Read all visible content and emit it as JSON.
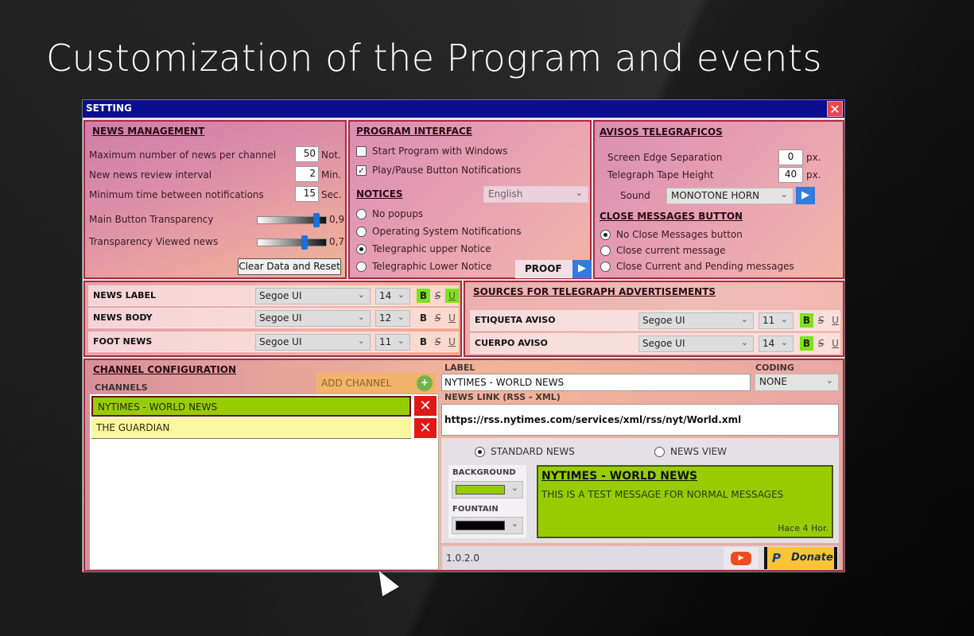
{
  "slide_title": "Customization of the Program and events",
  "window": {
    "title": "SETTING",
    "close_icon": "✕"
  },
  "news_management": {
    "heading": "NEWS MANAGEMENT",
    "rows": [
      {
        "label": "Maximum number of news per channel",
        "value": "50",
        "unit": "Not."
      },
      {
        "label": "New news review interval",
        "value": "2",
        "unit": "Min."
      },
      {
        "label": "Minimum time between notifications",
        "value": "15",
        "unit": "Sec."
      }
    ],
    "sliders": [
      {
        "label": "Main Button Transparency",
        "value": 0.9,
        "display": "0,9"
      },
      {
        "label": "Transparency Viewed news",
        "value": 0.7,
        "display": "0,7"
      }
    ],
    "reset_label": "Clear Data and Reset"
  },
  "program_interface": {
    "heading": "PROGRAM INTERFACE",
    "checkboxes": [
      {
        "label": "Start Program with Windows",
        "checked": false
      },
      {
        "label": "Play/Pause Button Notifications",
        "checked": true
      }
    ],
    "language": "English",
    "notices_heading": "NOTICES",
    "notices": [
      {
        "label": "No popups",
        "selected": false
      },
      {
        "label": "Operating System Notifications",
        "selected": false
      },
      {
        "label": "Telegraphic upper Notice",
        "selected": true
      },
      {
        "label": "Telegraphic Lower Notice",
        "selected": false
      }
    ],
    "proof_label": "PROOF"
  },
  "avisos": {
    "heading": "AVISOS TELEGRAFICOS",
    "rows": [
      {
        "label": "Screen Edge Separation",
        "value": "0",
        "unit": "px."
      },
      {
        "label": "Telegraph Tape Height",
        "value": "40",
        "unit": "px."
      }
    ],
    "sound_label": "Sound",
    "sound_value": "MONOTONE HORN",
    "close_heading": "CLOSE MESSAGES BUTTON",
    "close_options": [
      {
        "label": "No Close Messages button",
        "selected": true
      },
      {
        "label": "Close current message",
        "selected": false
      },
      {
        "label": "Close Current and Pending messages",
        "selected": false
      }
    ]
  },
  "fonts": [
    {
      "name": "NEWS LABEL",
      "font": "Segoe UI",
      "size": "14",
      "bold": true,
      "strike": false,
      "underline": true
    },
    {
      "name": "NEWS BODY",
      "font": "Segoe UI",
      "size": "12",
      "bold": false,
      "strike": false,
      "underline": false
    },
    {
      "name": "FOOT NEWS",
      "font": "Segoe UI",
      "size": "11",
      "bold": false,
      "strike": false,
      "underline": false
    }
  ],
  "telegraph_sources": {
    "heading": "SOURCES FOR TELEGRAPH ADVERTISEMENTS",
    "rows": [
      {
        "name": "ETIQUETA AVISO",
        "font": "Segoe UI",
        "size": "11",
        "bold": true,
        "strike": false,
        "underline": false
      },
      {
        "name": "CUERPO AVISO",
        "font": "Segoe UI",
        "size": "14",
        "bold": true,
        "strike": false,
        "underline": false
      }
    ]
  },
  "format_glyphs": {
    "bold": "B",
    "strike": "S",
    "underline": "U"
  },
  "channel_config": {
    "heading": "CHANNEL CONFIGURATION",
    "channels_label": "CHANNELS",
    "add_label": "ADD CHANNEL",
    "channels": [
      {
        "name": "NYTIMES - WORLD NEWS",
        "selected": true,
        "color": "#97cd00"
      },
      {
        "name": "THE GUARDIAN",
        "selected": false,
        "color": "#fbf7a0"
      }
    ],
    "label_caption": "LABEL",
    "label_value": "NYTIMES - WORLD NEWS",
    "coding_caption": "CODING",
    "coding_value": "NONE",
    "link_caption": "NEWS LINK (RSS - XML)",
    "link_value": "https://rss.nytimes.com/services/xml/rss/nyt/World.xml",
    "view_options": [
      {
        "label": "STANDARD NEWS",
        "selected": true
      },
      {
        "label": "NEWS VIEW",
        "selected": false
      }
    ],
    "background_caption": "BACKGROUND",
    "background_color": "#97cd00",
    "fountain_caption": "FOUNTAIN",
    "fountain_color": "#000000",
    "preview": {
      "title": "NYTIMES - WORLD NEWS",
      "body": "THIS IS A TEST MESSAGE FOR NORMAL MESSAGES",
      "time": "Hace 4 Hor."
    }
  },
  "footer": {
    "version": "1.0.2.0",
    "donate_label": "Donate"
  }
}
